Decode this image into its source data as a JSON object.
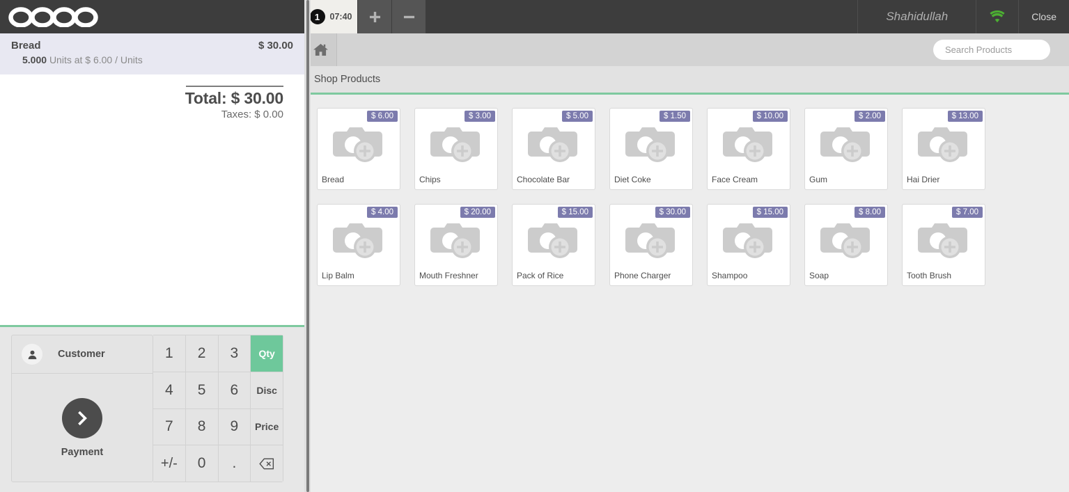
{
  "brand": {
    "logo_text": "odoo"
  },
  "order": {
    "lines": [
      {
        "name": "Bread",
        "price": "$ 30.00",
        "qty": "5.000",
        "uom_text": "Units at $ 6.00 / Units"
      }
    ],
    "total_label": "Total: $ 30.00",
    "taxes_label": "Taxes: $ 0.00"
  },
  "actionpad": {
    "customer_label": "Customer",
    "payment_label": "Payment",
    "customer_icon": "user-icon",
    "payment_icon": "chevron-right-icon"
  },
  "numpad": {
    "keys": [
      {
        "label": "1",
        "kind": "digit"
      },
      {
        "label": "2",
        "kind": "digit"
      },
      {
        "label": "3",
        "kind": "digit"
      },
      {
        "label": "Qty",
        "kind": "mode",
        "active": true
      },
      {
        "label": "4",
        "kind": "digit"
      },
      {
        "label": "5",
        "kind": "digit"
      },
      {
        "label": "6",
        "kind": "digit"
      },
      {
        "label": "Disc",
        "kind": "mode",
        "active": false
      },
      {
        "label": "7",
        "kind": "digit"
      },
      {
        "label": "8",
        "kind": "digit"
      },
      {
        "label": "9",
        "kind": "digit"
      },
      {
        "label": "Price",
        "kind": "mode",
        "active": false
      },
      {
        "label": "+/-",
        "kind": "sym"
      },
      {
        "label": "0",
        "kind": "digit"
      },
      {
        "label": ".",
        "kind": "digit"
      },
      {
        "label": "backspace-icon",
        "kind": "icon"
      }
    ]
  },
  "topbar": {
    "order_tab": {
      "badge": "1",
      "time": "07:40"
    },
    "add_order_icon": "plus-icon",
    "remove_order_icon": "minus-icon",
    "username": "Shahidullah",
    "sync_icon": "wifi-icon",
    "sync_color": "#4caf32",
    "close_label": "Close"
  },
  "breadcrumb": {
    "home_icon": "home-icon",
    "category_title": "Shop Products"
  },
  "search": {
    "placeholder": "Search Products",
    "value": "",
    "search_icon": "search-icon",
    "clear_icon": "close-icon"
  },
  "products": [
    {
      "name": "Bread",
      "price": "$ 6.00"
    },
    {
      "name": "Chips",
      "price": "$ 3.00"
    },
    {
      "name": "Chocolate Bar",
      "price": "$ 5.00"
    },
    {
      "name": "Diet Coke",
      "price": "$ 1.50"
    },
    {
      "name": "Face Cream",
      "price": "$ 10.00"
    },
    {
      "name": "Gum",
      "price": "$ 2.00"
    },
    {
      "name": "Hai Drier",
      "price": "$ 13.00"
    },
    {
      "name": "Lip Balm",
      "price": "$ 4.00"
    },
    {
      "name": "Mouth Freshner",
      "price": "$ 20.00"
    },
    {
      "name": "Pack of Rice",
      "price": "$ 15.00"
    },
    {
      "name": "Phone Charger",
      "price": "$ 30.00"
    },
    {
      "name": "Shampoo",
      "price": "$ 15.00"
    },
    {
      "name": "Soap",
      "price": "$ 8.00"
    },
    {
      "name": "Tooth Brush",
      "price": "$ 7.00"
    }
  ],
  "colors": {
    "accent_green": "#7ec99f",
    "odoo_purple": "#7c7bad",
    "header_dark": "#3d3d3d"
  }
}
